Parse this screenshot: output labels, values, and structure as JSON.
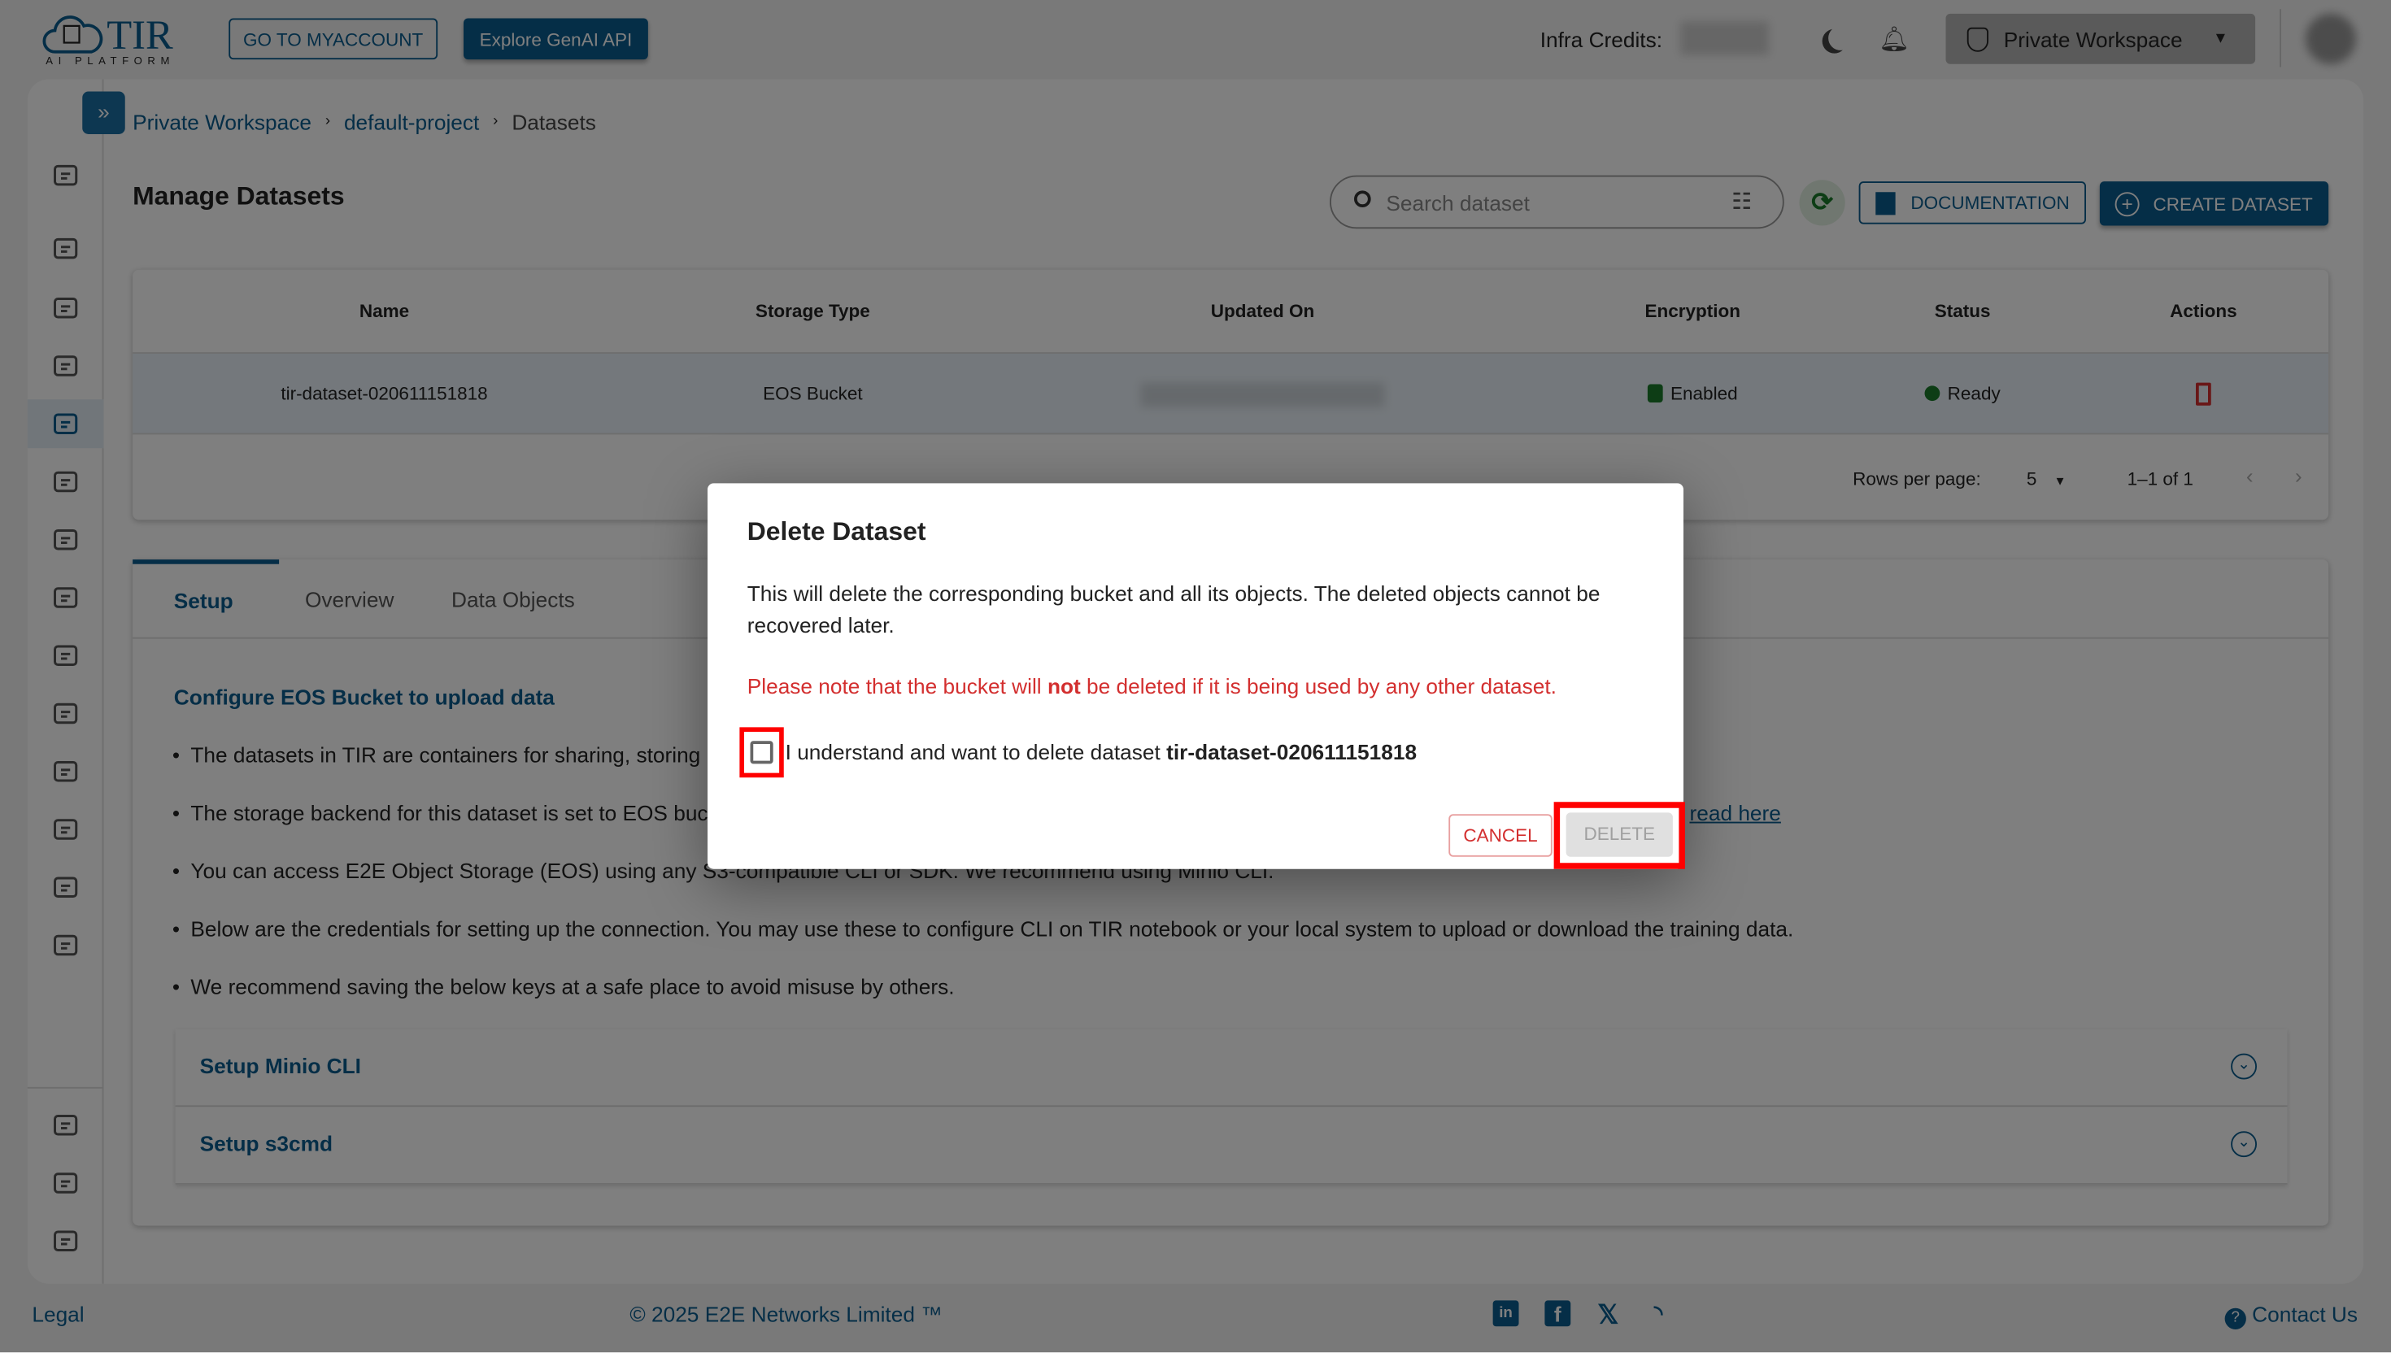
{
  "header": {
    "logo_text": "TIR",
    "logo_sub": "AI PLATFORM",
    "myaccount_label": "GO TO MYACCOUNT",
    "genai_label": "Explore GenAI API",
    "credits_label": "Infra Credits:",
    "workspace_label": "Private Workspace"
  },
  "breadcrumb": [
    "Private Workspace",
    "default-project",
    "Datasets"
  ],
  "page": {
    "title": "Manage Datasets",
    "search_placeholder": "Search dataset",
    "documentation_label": "DOCUMENTATION",
    "create_label": "CREATE DATASET"
  },
  "table": {
    "columns": [
      "Name",
      "Storage Type",
      "Updated On",
      "Encryption",
      "Status",
      "Actions"
    ],
    "rows": [
      {
        "name": "tir-dataset-020611151818",
        "storage": "EOS Bucket",
        "encryption": "Enabled",
        "status": "Ready"
      }
    ],
    "rows_per_page_label": "Rows per page:",
    "rows_per_page": "5",
    "range": "1–1 of 1"
  },
  "tabs": [
    {
      "label": "Setup",
      "active": true
    },
    {
      "label": "Overview"
    },
    {
      "label": "Data Objects"
    }
  ],
  "setup": {
    "heading": "Configure EOS Bucket to upload data",
    "bullets": [
      "The datasets in TIR are containers for sharing, storing",
      "The storage backend for this dataset is set to EOS bucket.",
      "You can access E2E Object Storage (EOS) using any S3-compatible CLI or SDK. We recommend using Minio CLI.",
      "Below are the credentials for setting up the connection. You may use these to configure CLI on TIR notebook or your local system to upload or download the training data.",
      "We recommend saving the below keys at a safe place to avoid misuse by others."
    ],
    "read_here": "read here",
    "accordions": [
      "Setup Minio CLI",
      "Setup s3cmd"
    ]
  },
  "footer": {
    "legal": "Legal",
    "copyright": "© 2025 E2E Networks Limited ™",
    "contact": "Contact Us",
    "social": [
      "linkedin-icon",
      "facebook-icon",
      "x-icon",
      "rss-icon"
    ]
  },
  "modal": {
    "title": "Delete Dataset",
    "body": "This will delete the corresponding bucket and all its objects. The deleted objects cannot be recovered later.",
    "note_pre": "Please note that the bucket will ",
    "note_bold": "not",
    "note_post": " be deleted if it is being used by any other dataset.",
    "confirm_text": "I understand and want to delete dataset ",
    "confirm_name": "tir-dataset-020611151818",
    "confirm_checked": false,
    "cancel_label": "CANCEL",
    "delete_label": "DELETE",
    "delete_enabled": false
  },
  "colors": {
    "brand": "#0b5d8f",
    "danger": "#d32f2f",
    "success": "#1b7a2b",
    "highlight": "#ff0000"
  }
}
